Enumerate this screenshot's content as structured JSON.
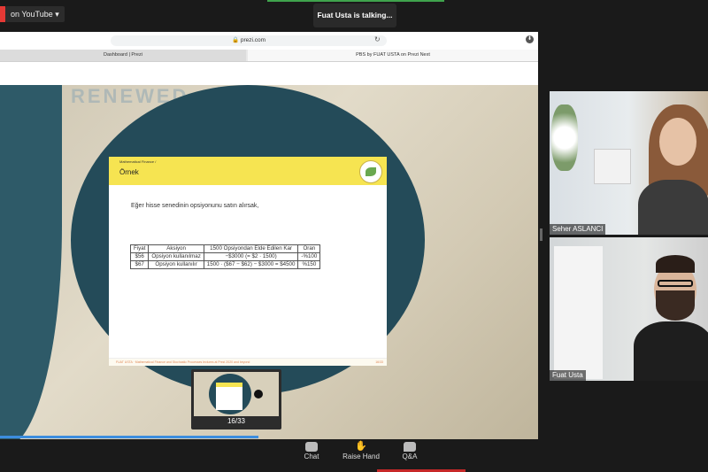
{
  "topbar": {
    "stream_label": "on YouTube",
    "stream_caret": "▾",
    "speaker_status": "Fuat Usta is talking..."
  },
  "browser": {
    "url": "🔒 prezi.com",
    "reload_glyph": "↻",
    "download_glyph": "⬇",
    "tabs": [
      {
        "label": "Dashboard | Prezi"
      },
      {
        "label": "PBS by FUAT USTA on Prezi Next"
      }
    ]
  },
  "prezi": {
    "banner_text": "RENEWED",
    "slide": {
      "breadcrumb": "Mathematical Finance  /",
      "title": "Örnek",
      "text": "Eğer hisse senedinin opsiyonunu satın alırsak,",
      "table": {
        "headers": [
          "Fiyat",
          "Aksiyon",
          "1500 Opsiyondan Elde Edilen Kar",
          "Oran"
        ],
        "rows": [
          [
            "$56",
            "Opsiyon kullanılmaz",
            "−$3000 (= $2 · 1500)",
            "-%100"
          ],
          [
            "$67",
            "Opsiyon kullanılır",
            "1500 · ($67 − $62) − $3000 = $4500",
            "%150"
          ]
        ]
      },
      "footer": "FUAT USTA  ·  Mathematical Finance and Stochastic Processes lectures at Prezi 2020 and beyond",
      "page_number": "16/33"
    },
    "thumbnail_label": "16/33",
    "progress_fraction": 0.48
  },
  "participants": [
    {
      "name": "Seher ASLANCI"
    },
    {
      "name": "Fuat Usta"
    }
  ],
  "controls": {
    "chat_label": "Chat",
    "raise_hand_label": "Raise Hand",
    "qa_label": "Q&A",
    "hand_glyph": "✋"
  }
}
